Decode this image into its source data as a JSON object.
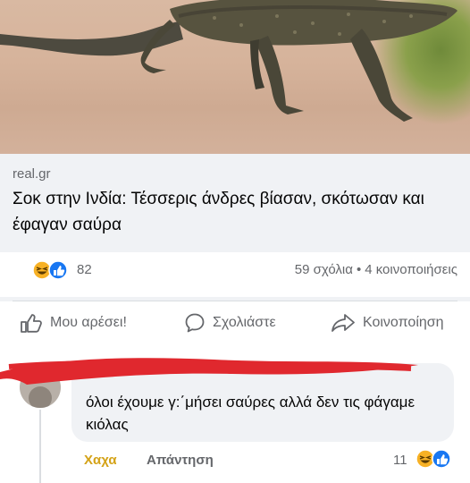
{
  "post": {
    "source": "real.gr",
    "headline": "Σοκ στην Ινδία: Τέσσερις άνδρες βίασαν, σκότωσαν και έφαγαν σαύρα"
  },
  "reactions": {
    "count": "82",
    "comments": "59 σχόλια",
    "separator": "•",
    "shares": "4 κοινοποιήσεις"
  },
  "actions": {
    "like": "Μου αρέσει!",
    "comment": "Σχολιάστε",
    "share": "Κοινοποίηση"
  },
  "comment": {
    "text": "όλοι έχουμε γ:΄μήσει σαύρες αλλά δεν τις φάγαμε κιόλας",
    "haha": "Χαχα",
    "reply": "Απάντηση",
    "reaction_count": "11"
  },
  "colors": {
    "like_blue": "#1877f2",
    "haha_yellow": "#f7b125",
    "scribble_red": "#e0282e"
  }
}
